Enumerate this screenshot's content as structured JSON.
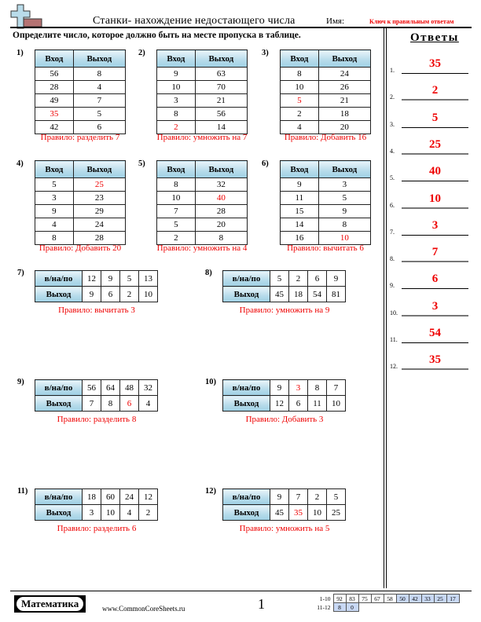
{
  "header": {
    "title": "Станки- нахождение недостающего числа",
    "name_label": "Имя:",
    "answer_key_label": "Ключ к правильным ответам",
    "instructions": "Определите число, которое должно быть на месте пропуска в таблице."
  },
  "vertical_tables": {
    "col_in": "Вход",
    "col_out": "Выход",
    "problems": [
      {
        "num": "1)",
        "rows": [
          [
            "56",
            "8"
          ],
          [
            "28",
            "4"
          ],
          [
            "49",
            "7"
          ],
          [
            "35",
            "5"
          ],
          [
            "42",
            "6"
          ]
        ],
        "rule": "Правило: разделить 7",
        "missing": [
          3,
          0
        ]
      },
      {
        "num": "2)",
        "rows": [
          [
            "9",
            "63"
          ],
          [
            "10",
            "70"
          ],
          [
            "3",
            "21"
          ],
          [
            "8",
            "56"
          ],
          [
            "2",
            "14"
          ]
        ],
        "rule": "Правило: умножить на 7",
        "missing": [
          4,
          0
        ]
      },
      {
        "num": "3)",
        "rows": [
          [
            "8",
            "24"
          ],
          [
            "10",
            "26"
          ],
          [
            "5",
            "21"
          ],
          [
            "2",
            "18"
          ],
          [
            "4",
            "20"
          ]
        ],
        "rule": "Правило: Добавить 16",
        "missing": [
          2,
          0
        ]
      },
      {
        "num": "4)",
        "rows": [
          [
            "5",
            "25"
          ],
          [
            "3",
            "23"
          ],
          [
            "9",
            "29"
          ],
          [
            "4",
            "24"
          ],
          [
            "8",
            "28"
          ]
        ],
        "rule": "Правило: Добавить 20",
        "missing": [
          0,
          1
        ]
      },
      {
        "num": "5)",
        "rows": [
          [
            "8",
            "32"
          ],
          [
            "10",
            "40"
          ],
          [
            "7",
            "28"
          ],
          [
            "5",
            "20"
          ],
          [
            "2",
            "8"
          ]
        ],
        "rule": "Правило: умножить на 4",
        "missing": [
          1,
          1
        ]
      },
      {
        "num": "6)",
        "rows": [
          [
            "9",
            "3"
          ],
          [
            "11",
            "5"
          ],
          [
            "15",
            "9"
          ],
          [
            "14",
            "8"
          ],
          [
            "16",
            "10"
          ]
        ],
        "rule": "Правило: вычитать 6",
        "missing": [
          4,
          1
        ]
      }
    ]
  },
  "horizontal_tables": {
    "row_in": "в/на/по",
    "row_out": "Выход",
    "problems": [
      {
        "num": "7)",
        "in": [
          "12",
          "9",
          "5",
          "13"
        ],
        "out": [
          "9",
          "6",
          "2",
          "10"
        ],
        "rule": "Правило: вычитать 3",
        "missing": null
      },
      {
        "num": "8)",
        "in": [
          "5",
          "2",
          "6",
          "9"
        ],
        "out": [
          "45",
          "18",
          "54",
          "81"
        ],
        "rule": "Правило: умножить на 9",
        "missing": null
      },
      {
        "num": "9)",
        "in": [
          "56",
          "64",
          "48",
          "32"
        ],
        "out": [
          "7",
          "8",
          "6",
          "4"
        ],
        "rule": "Правило: разделить 8",
        "missing": [
          "out",
          2
        ]
      },
      {
        "num": "10)",
        "in": [
          "9",
          "3",
          "8",
          "7"
        ],
        "out": [
          "12",
          "6",
          "11",
          "10"
        ],
        "rule": "Правило: Добавить 3",
        "missing": [
          "in",
          1
        ]
      },
      {
        "num": "11)",
        "in": [
          "18",
          "60",
          "24",
          "12"
        ],
        "out": [
          "3",
          "10",
          "4",
          "2"
        ],
        "rule": "Правило: разделить 6",
        "missing": null
      },
      {
        "num": "12)",
        "in": [
          "9",
          "7",
          "2",
          "5"
        ],
        "out": [
          "45",
          "35",
          "10",
          "25"
        ],
        "rule": "Правило: умножить на 5",
        "missing": [
          "out",
          1
        ]
      }
    ]
  },
  "answers": {
    "title": "Ответы",
    "items": [
      {
        "num": "1.",
        "value": "35"
      },
      {
        "num": "2.",
        "value": "2"
      },
      {
        "num": "3.",
        "value": "5"
      },
      {
        "num": "4.",
        "value": "25"
      },
      {
        "num": "5.",
        "value": "40"
      },
      {
        "num": "6.",
        "value": "10"
      },
      {
        "num": "7.",
        "value": "3"
      },
      {
        "num": "8.",
        "value": "7"
      },
      {
        "num": "9.",
        "value": "6"
      },
      {
        "num": "10.",
        "value": "3"
      },
      {
        "num": "11.",
        "value": "54"
      },
      {
        "num": "12.",
        "value": "35"
      }
    ]
  },
  "footer": {
    "brand": "Математика",
    "site": "www.CommonCoreSheets.ru",
    "page": "1",
    "score_rows": [
      {
        "label": "1-10",
        "cells": [
          "92",
          "83",
          "75",
          "67",
          "58",
          "50",
          "42",
          "33",
          "25",
          "17"
        ]
      },
      {
        "label": "11-12",
        "cells": [
          "8",
          "0"
        ]
      }
    ]
  },
  "colors": {
    "answer_red": "#ee0000",
    "header_blue": "#b6dbea",
    "score_blue": "#c8d8f4"
  }
}
